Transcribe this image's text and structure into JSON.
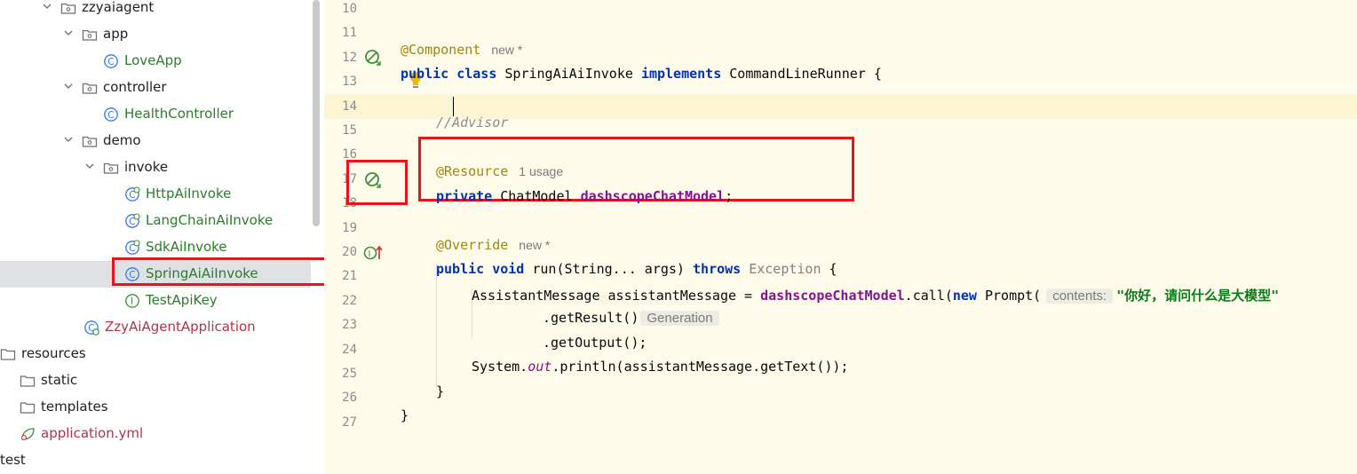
{
  "project_tree": {
    "items": [
      {
        "label": "zzyaiagent",
        "kind": "package",
        "icon": "package-icon",
        "expanded": true
      },
      {
        "label": "app",
        "kind": "package",
        "icon": "package-icon",
        "expanded": true
      },
      {
        "label": "LoveApp",
        "kind": "class",
        "icon": "class-icon"
      },
      {
        "label": "controller",
        "kind": "package",
        "icon": "package-icon",
        "expanded": true
      },
      {
        "label": "HealthController",
        "kind": "class",
        "icon": "class-icon"
      },
      {
        "label": "demo",
        "kind": "package",
        "icon": "package-icon",
        "expanded": true
      },
      {
        "label": "invoke",
        "kind": "package",
        "icon": "package-icon",
        "expanded": true
      },
      {
        "label": "HttpAiInvoke",
        "kind": "spring-class",
        "icon": "spring-class-icon"
      },
      {
        "label": "LangChainAiInvoke",
        "kind": "spring-class",
        "icon": "spring-class-icon"
      },
      {
        "label": "SdkAiInvoke",
        "kind": "spring-class",
        "icon": "spring-class-icon"
      },
      {
        "label": "SpringAiAiInvoke",
        "kind": "class",
        "icon": "class-icon",
        "selected": true
      },
      {
        "label": "TestApiKey",
        "kind": "interface",
        "icon": "interface-icon"
      },
      {
        "label": "ZzyAiAgentApplication",
        "kind": "spring-app",
        "icon": "spring-boot-class-icon"
      },
      {
        "label": "resources",
        "kind": "folder",
        "icon": "folder-icon"
      },
      {
        "label": "static",
        "kind": "folder",
        "icon": "folder-icon"
      },
      {
        "label": "templates",
        "kind": "folder",
        "icon": "folder-icon"
      },
      {
        "label": "application.yml",
        "kind": "yaml",
        "icon": "spring-config-icon"
      },
      {
        "label": "test",
        "kind": "folder"
      }
    ]
  },
  "editor": {
    "line_numbers": [
      "10",
      "11",
      "12",
      "13",
      "14",
      "15",
      "16",
      "17",
      "18",
      "19",
      "20",
      "21",
      "22",
      "23",
      "24",
      "25",
      "26",
      "27"
    ],
    "line11": {
      "annotation": "@Component",
      "hint": "new *"
    },
    "line12": {
      "kw1": "public",
      "kw2": "class",
      "name": "SpringAiAiInvoke",
      "kw3": "implements",
      "iface": "CommandLineRunner",
      "brace": "{"
    },
    "line14": {
      "comment_prefix": "//",
      "comment_text": "Advisor"
    },
    "line16": {
      "annotation": "@Resource",
      "hint": "1 usage"
    },
    "line17": {
      "kw": "private",
      "type": "ChatModel",
      "field": "dashscopeChatModel",
      "end": ";"
    },
    "line19": {
      "annotation": "@Override",
      "hint": "new *"
    },
    "line20": {
      "kw1": "public",
      "kw2": "void",
      "sig": "run(String... args)",
      "kw3": "throws",
      "exc": "Exception",
      "brace": "{"
    },
    "line21": {
      "decl": "AssistantMessage assistantMessage = ",
      "field": "dashscopeChatModel",
      "call": ".call(",
      "kw": "new",
      "ctor": "Prompt(",
      "param_hint": "contents:",
      "str": "\"你好，请问什么是大模型\""
    },
    "line22": {
      "code": ".getResult()",
      "type_hint": "Generation"
    },
    "line23": {
      "code": ".getOutput();"
    },
    "line24": {
      "pre": "System.",
      "static": "out",
      "post": ".println(assistantMessage.getText());"
    },
    "line25": {
      "code": "}"
    },
    "line26": {
      "code": "}"
    }
  },
  "colors": {
    "editor_bg": "#fffbeb",
    "keyword": "#0033b3",
    "annotation": "#9e880d",
    "field": "#871094",
    "string": "#067d17",
    "highlight_box": "#e8141b"
  }
}
